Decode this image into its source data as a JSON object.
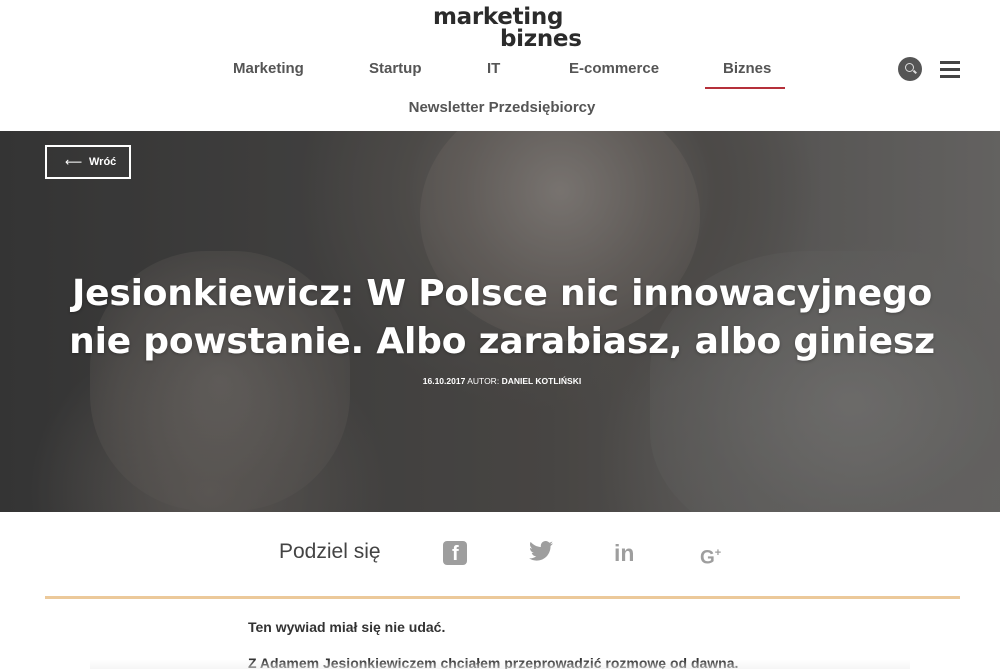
{
  "brand": {
    "logo_line1": "marketing",
    "logo_line2": "biznes",
    "accent_color": "#f2c230"
  },
  "nav": {
    "items": [
      {
        "label": "Marketing"
      },
      {
        "label": "Startup"
      },
      {
        "label": "IT"
      },
      {
        "label": "E-commerce"
      },
      {
        "label": "Biznes",
        "active": true
      }
    ],
    "second_row": "Newsletter Przedsiębiorcy",
    "active_color": "#b5303a",
    "search_icon": "search-icon",
    "menu_icon": "hamburger-menu-icon"
  },
  "hero": {
    "back_label": "Wróć",
    "back_icon": "arrow-left-icon",
    "title": "Jesionkiewicz: W Polsce nic innowacyjnego nie powstanie. Albo zarabiasz, albo giniesz",
    "date": "16.10.2017",
    "author_label": "AUTOR:",
    "author": "DANIEL KOTLIŃSKI"
  },
  "share": {
    "label": "Podziel się",
    "icons": [
      "facebook-icon",
      "twitter-icon",
      "linkedin-icon",
      "google-plus-icon"
    ],
    "icon_color": "#9e9e9e",
    "divider_color": "#ecc99a"
  },
  "article": {
    "p1": "Ten wywiad miał się nie udać.",
    "p2": "Z Adamem Jesionkiewiczem chciałem przeprowadzić rozmowę od dawna."
  }
}
